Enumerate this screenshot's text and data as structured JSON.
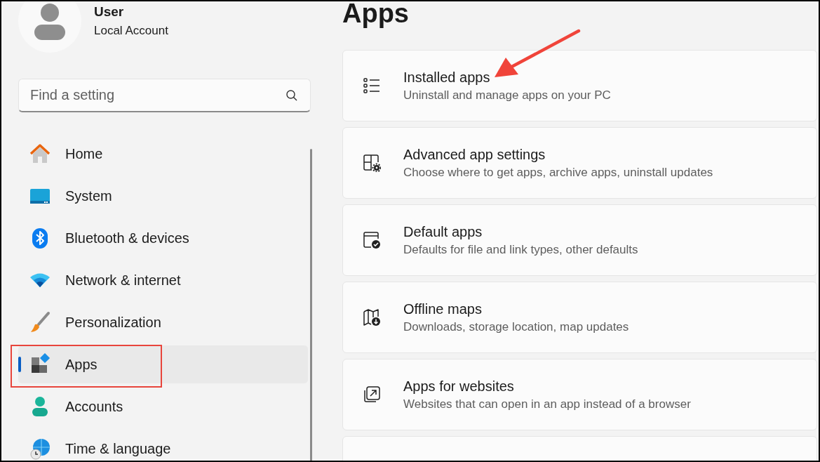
{
  "user": {
    "name": "User",
    "account_type": "Local Account"
  },
  "search": {
    "placeholder": "Find a setting"
  },
  "nav": [
    {
      "label": "Home",
      "kind": "home",
      "selected": false
    },
    {
      "label": "System",
      "kind": "system",
      "selected": false
    },
    {
      "label": "Bluetooth & devices",
      "kind": "bluetooth",
      "selected": false
    },
    {
      "label": "Network & internet",
      "kind": "network",
      "selected": false
    },
    {
      "label": "Personalization",
      "kind": "brush",
      "selected": false
    },
    {
      "label": "Apps",
      "kind": "apps",
      "selected": true
    },
    {
      "label": "Accounts",
      "kind": "person",
      "selected": false
    },
    {
      "label": "Time & language",
      "kind": "time",
      "selected": false
    }
  ],
  "page": {
    "title": "Apps"
  },
  "settings": [
    {
      "title": "Installed apps",
      "description": "Uninstall and manage apps on your PC",
      "kind": "list"
    },
    {
      "title": "Advanced app settings",
      "description": "Choose where to get apps, archive apps, uninstall updates",
      "kind": "gear"
    },
    {
      "title": "Default apps",
      "description": "Defaults for file and link types, other defaults",
      "kind": "check"
    },
    {
      "title": "Offline maps",
      "description": "Downloads, storage location, map updates",
      "kind": "map"
    },
    {
      "title": "Apps for websites",
      "description": "Websites that can open in an app instead of a browser",
      "kind": "link"
    },
    {
      "kind": "partial"
    }
  ],
  "annotations": {
    "arrow": true,
    "highlight_box": true
  }
}
